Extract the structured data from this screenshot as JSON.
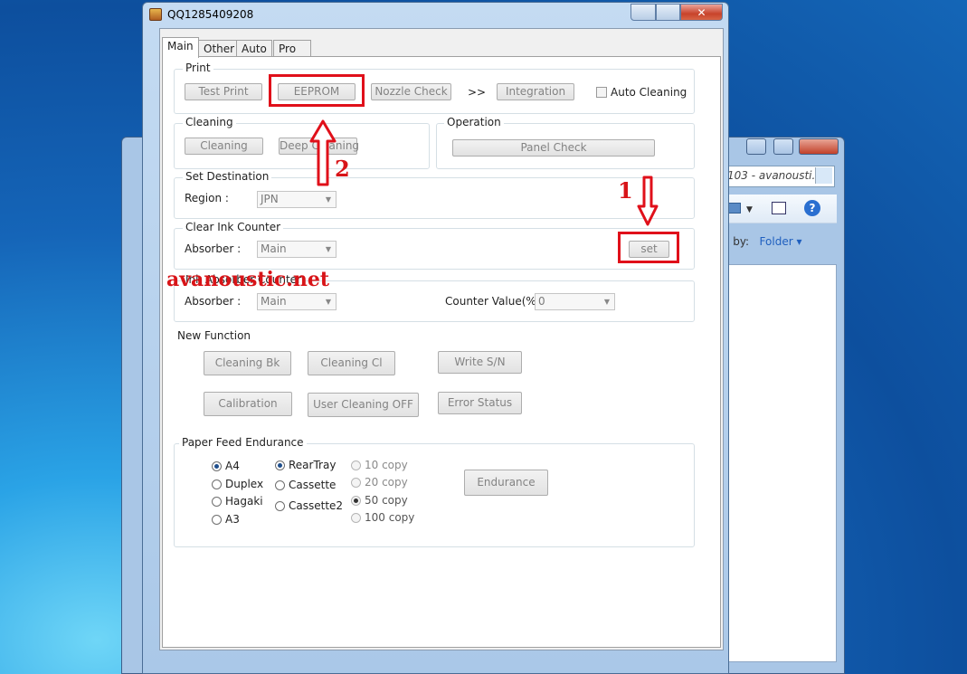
{
  "window": {
    "title": "QQ1285409208",
    "close_glyph": "✕"
  },
  "background_window": {
    "address_text": "103 - avanousti...",
    "arrange_label": "e by:",
    "arrange_value": "Folder ▾"
  },
  "tabs": [
    {
      "label": "Main"
    },
    {
      "label": "Other"
    },
    {
      "label": "Auto"
    },
    {
      "label": "Pro"
    }
  ],
  "print": {
    "label": "Print",
    "test_print": "Test Print",
    "eeprom": "EEPROM",
    "nozzle_check": "Nozzle Check",
    "chevrons": ">>",
    "integration": "Integration",
    "auto_cleaning": "Auto Cleaning"
  },
  "cleaning": {
    "label": "Cleaning",
    "cleaning": "Cleaning",
    "deep_cleaning": "Deep Cleaning"
  },
  "operation": {
    "label": "Operation",
    "panel_check": "Panel Check"
  },
  "destination": {
    "label": "Set Destination",
    "region_label": "Region :",
    "region_value": "JPN"
  },
  "clear_ink": {
    "label": "Clear Ink Counter",
    "absorber_label": "Absorber :",
    "absorber_value": "Main",
    "set_button": "set"
  },
  "ink_absorber": {
    "label": "Ink Absorber Counter",
    "absorber_label": "Absorber :",
    "absorber_value": "Main",
    "counter_label": "Counter Value(%) :",
    "counter_value": "0"
  },
  "new_function": {
    "label": "New Function",
    "cleaning_bk": "Cleaning Bk",
    "cleaning_cl": "Cleaning Cl",
    "write_sn": "Write S/N",
    "calibration": "Calibration",
    "user_cleaning_off": "User Cleaning OFF",
    "error_status": "Error Status"
  },
  "paper_feed": {
    "label": "Paper Feed Endurance",
    "sizes": [
      {
        "label": "A4",
        "selected": true
      },
      {
        "label": "Duplex",
        "selected": false
      },
      {
        "label": "Hagaki",
        "selected": false
      },
      {
        "label": "A3",
        "selected": false
      }
    ],
    "trays": [
      {
        "label": "RearTray",
        "selected": true
      },
      {
        "label": "Cassette",
        "selected": false
      },
      {
        "label": "Cassette2",
        "selected": false
      }
    ],
    "copies": [
      {
        "label": "10 copy",
        "selected": false
      },
      {
        "label": "20 copy",
        "selected": false
      },
      {
        "label": "50 copy",
        "selected": true
      },
      {
        "label": "100 copy",
        "selected": false
      }
    ],
    "endurance_button": "Endurance"
  },
  "annotations": {
    "step1": "1",
    "step2": "2",
    "watermark": "avanoustic.net",
    "color": "#e0101a"
  }
}
